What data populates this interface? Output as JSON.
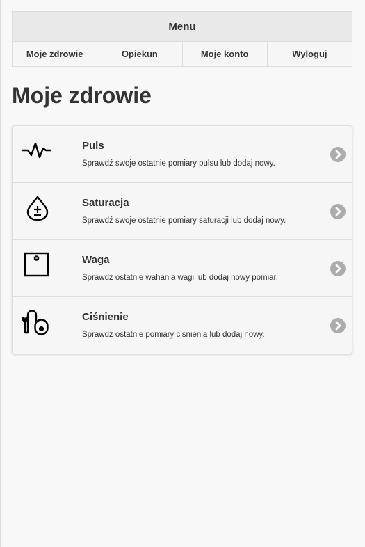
{
  "menu": {
    "title": "Menu",
    "items": [
      {
        "label": "Moje zdrowie"
      },
      {
        "label": "Opiekun"
      },
      {
        "label": "Moje konto"
      },
      {
        "label": "Wyloguj"
      }
    ]
  },
  "page": {
    "title": "Moje zdrowie"
  },
  "health_items": [
    {
      "title": "Puls",
      "description": "Sprawdź swoje ostatnie pomiary pulsu lub dodaj nowy.",
      "icon": "pulse-icon"
    },
    {
      "title": "Saturacja",
      "description": "Sprawdź swoje ostatnie pomiary saturacji lub dodaj nowy.",
      "icon": "drop-icon"
    },
    {
      "title": "Waga",
      "description": "Sprawdź ostatnie wahania wagi lub dodaj nowy pomiar.",
      "icon": "scale-icon"
    },
    {
      "title": "Ciśnienie",
      "description": "Sprawdź ostatnie pomiary ciśnienia lub dodaj nowy.",
      "icon": "blood-pressure-icon"
    }
  ],
  "colors": {
    "background": "#f8f8f8",
    "header": "#e9e9e9",
    "border": "#dddddd",
    "text": "#333333",
    "chevron": "#acacac"
  }
}
